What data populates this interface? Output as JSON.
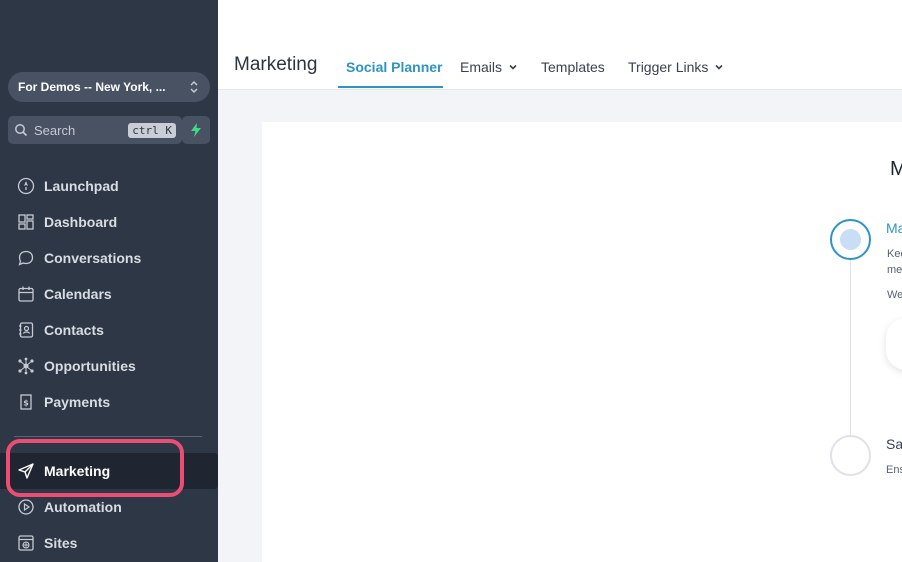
{
  "sidebar": {
    "location": "For Demos -- New York, ...",
    "search_placeholder": "Search",
    "search_shortcut": "ctrl K",
    "items": [
      {
        "label": "Launchpad",
        "icon": "rocket-icon"
      },
      {
        "label": "Dashboard",
        "icon": "grid-icon"
      },
      {
        "label": "Conversations",
        "icon": "chat-bubble-icon"
      },
      {
        "label": "Calendars",
        "icon": "calendar-icon"
      },
      {
        "label": "Contacts",
        "icon": "contact-book-icon"
      },
      {
        "label": "Opportunities",
        "icon": "network-icon"
      },
      {
        "label": "Payments",
        "icon": "receipt-icon"
      },
      {
        "label": "Marketing",
        "icon": "paper-plane-icon",
        "active": true
      },
      {
        "label": "Automation",
        "icon": "play-circle-icon"
      },
      {
        "label": "Sites",
        "icon": "globe-window-icon"
      }
    ]
  },
  "header": {
    "title": "Marketing",
    "tabs": [
      {
        "label": "Social Planner",
        "active": true
      },
      {
        "label": "Emails",
        "dropdown": true
      },
      {
        "label": "Templates"
      },
      {
        "label": "Trigger Links",
        "dropdown": true
      }
    ]
  },
  "main": {
    "heading": "M",
    "steps": [
      {
        "title": "Ma",
        "desc_lines": [
          "Kee",
          "me",
          "We"
        ],
        "active": true
      },
      {
        "title": "Sa",
        "desc_lines": [
          "Ens"
        ],
        "active": false
      }
    ]
  },
  "colors": {
    "sidebar_bg": "#2e3745",
    "accent": "#2e94c4",
    "highlight": "#ec4d74",
    "bolt": "#3ddc84"
  }
}
